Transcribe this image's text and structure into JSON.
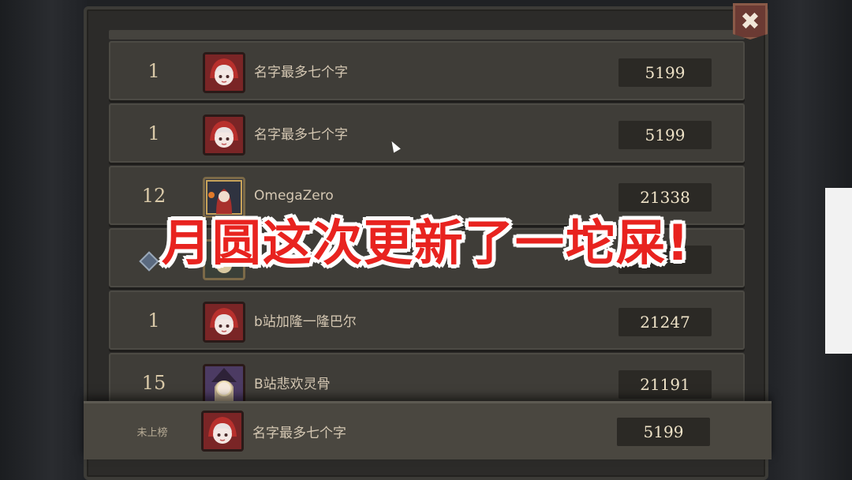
{
  "leaderboard": {
    "close_label": "✖",
    "rows": [
      {
        "rank": "1",
        "name": "名字最多七个字",
        "score": "5199",
        "avatar": "red-hood-avatar"
      },
      {
        "rank": "1",
        "name": "名字最多七个字",
        "score": "5199",
        "avatar": "red-hood-avatar"
      },
      {
        "rank": "12",
        "name": "OmegaZero",
        "score": "21338",
        "avatar": "card-character-avatar"
      },
      {
        "rank": "",
        "name": "",
        "score": "",
        "avatar": "card-character-avatar"
      },
      {
        "rank": "1",
        "name": "b站加隆一隆巴尔",
        "score": "21247",
        "avatar": "red-hood-avatar"
      },
      {
        "rank": "15",
        "name": "B站悲欢灵骨",
        "score": "21191",
        "avatar": "witch-avatar"
      }
    ],
    "self_row": {
      "rank": "未上榜",
      "name": "名字最多七个字",
      "score": "5199",
      "avatar": "red-hood-avatar"
    }
  },
  "caption": "月圆这次更新了一坨屎!",
  "colors": {
    "caption_red": "#e8231f",
    "row_bg": "#3f3d38",
    "score_text": "#efe3c8"
  }
}
